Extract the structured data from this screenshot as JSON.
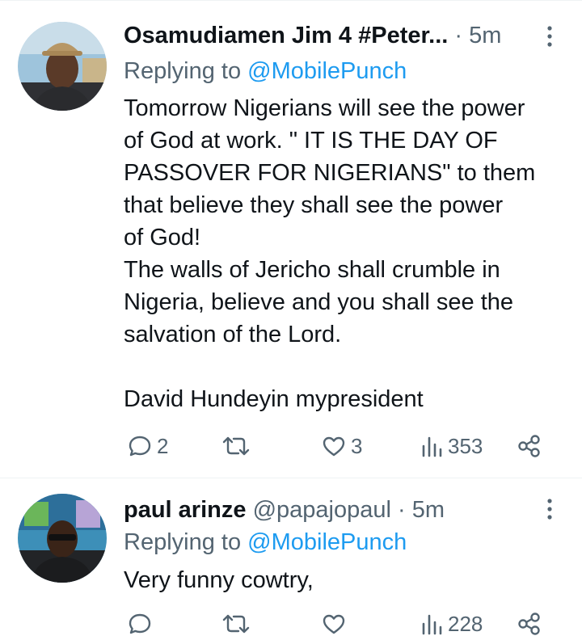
{
  "tweets": [
    {
      "display_name": "Osamudiamen Jim 4 #Peter...",
      "time": "· 5m",
      "replying_prefix": "Replying to",
      "replying_handle": "@MobilePunch",
      "text": "Tomorrow Nigerians will see the power\nof God at work. \" IT IS THE DAY OF\nPASSOVER FOR NIGERIANS\" to them\nthat believe they shall see the power\nof God!\nThe walls of Jericho shall crumble in\nNigeria, believe and you shall see the\nsalvation of the Lord.\n\nDavid Hundeyin mypresident",
      "replies": "2",
      "reposts": "",
      "likes": "3",
      "views": "353"
    },
    {
      "display_name": "paul arinze",
      "handle": "@papajopaul",
      "time": "· 5m",
      "replying_prefix": "Replying to",
      "replying_handle": "@MobilePunch",
      "text": "Very funny cowtry,",
      "replies": "",
      "reposts": "",
      "likes": "",
      "views": "228"
    }
  ],
  "colors": {
    "text": "#0f1419",
    "secondary": "#536471",
    "link": "#1d9bf0",
    "divider": "#eff3f4"
  },
  "icons": [
    "more-vertical-icon",
    "reply-icon",
    "repost-icon",
    "like-icon",
    "views-icon",
    "share-icon"
  ]
}
